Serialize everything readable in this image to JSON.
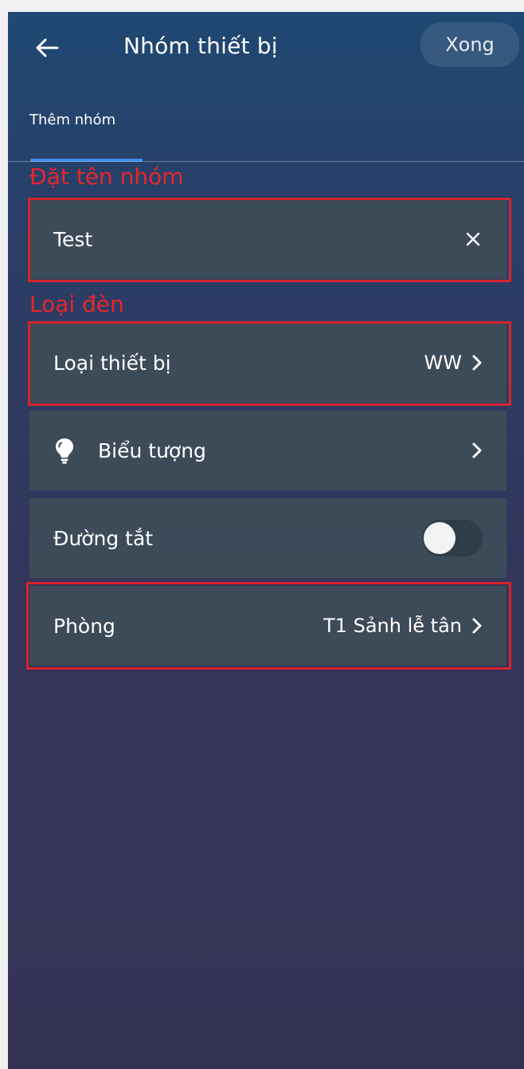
{
  "header": {
    "title": "Nhóm thiết bị",
    "done_label": "Xong"
  },
  "tabs": [
    {
      "label": "Thêm nhóm",
      "active": true
    }
  ],
  "annotations": {
    "group_name_label": "Đặt tên nhóm",
    "light_type_label": "Loại đèn",
    "color": "#e8262b"
  },
  "form": {
    "group_name": {
      "value": "Test"
    },
    "device_type": {
      "label": "Loại thiết bị",
      "value": "WW"
    },
    "icon": {
      "label": "Biểu tượng",
      "icon": "lightbulb-icon"
    },
    "shortcut": {
      "label": "Đường tắt",
      "enabled": false
    },
    "room": {
      "label": "Phòng",
      "value": "T1 Sảnh lễ tân"
    }
  },
  "colors": {
    "accent": "#3f8de8",
    "highlight": "#d7232b"
  }
}
